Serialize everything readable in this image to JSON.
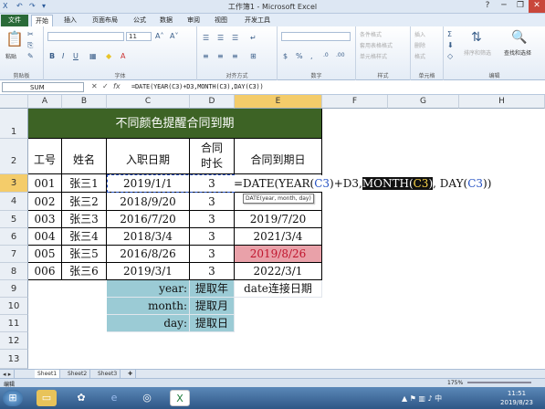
{
  "window": {
    "title": "工作簿1 - Microsoft Excel",
    "quick_access": [
      "X",
      "↶",
      "↷",
      "▾"
    ],
    "controls": [
      "?",
      "─",
      "❐",
      "✕"
    ]
  },
  "ribbon": {
    "tabs": [
      "文件",
      "开始",
      "插入",
      "页面布局",
      "公式",
      "数据",
      "审阅",
      "视图",
      "开发工具"
    ],
    "active_tab": "开始",
    "groups": [
      "剪贴板",
      "字体",
      "对齐方式",
      "数字",
      "样式",
      "单元格",
      "编辑"
    ],
    "paste_label": "粘贴",
    "font_size": "11",
    "style_items": [
      "条件格式",
      "套用表格格式",
      "单元格样式"
    ],
    "cell_items": [
      "插入",
      "删除",
      "格式"
    ],
    "edit_items": [
      "排序和筛选",
      "查找和选择"
    ]
  },
  "formula_bar": {
    "name_box": "SUM",
    "formula": "=DATE(YEAR(C3)+D3,MONTH(C3),DAY(C3))"
  },
  "sheet": {
    "columns": [
      "A",
      "B",
      "C",
      "D",
      "E",
      "F",
      "G",
      "H"
    ],
    "rows": [
      "1",
      "2",
      "3",
      "4",
      "5",
      "6",
      "7",
      "8",
      "9",
      "10",
      "11",
      "12",
      "13"
    ],
    "title": "不同颜色提醒合同到期",
    "headers": [
      "工号",
      "姓名",
      "入职日期",
      "合同时长",
      "合同到期日"
    ],
    "data": [
      [
        "001",
        "张三1",
        "2019/1/1",
        "3",
        ""
      ],
      [
        "002",
        "张三2",
        "2018/9/20",
        "3",
        ""
      ],
      [
        "003",
        "张三3",
        "2016/7/20",
        "3",
        "2019/7/20"
      ],
      [
        "004",
        "张三4",
        "2018/3/4",
        "3",
        "2021/3/4"
      ],
      [
        "005",
        "张三5",
        "2016/8/26",
        "3",
        "2019/8/26"
      ],
      [
        "006",
        "张三6",
        "2019/3/1",
        "3",
        "2022/3/1"
      ]
    ],
    "notes": [
      {
        "label": "year:",
        "value": "提取年",
        "extra": "date连接日期"
      },
      {
        "label": "month:",
        "value": "提取月",
        "extra": ""
      },
      {
        "label": "day:",
        "value": "提取日",
        "extra": ""
      }
    ],
    "editor": {
      "p1": "=DATE(YEAR(",
      "r1": "C3",
      "p2": ")+D3,",
      "month": "MONTH(",
      "r2": "C3",
      "p3": ")",
      "p4": ", DAY(",
      "r3": "C3",
      "p5": "))"
    },
    "tooltip": "DATE(year, month, day)"
  },
  "sheet_tabs": [
    "Sheet1",
    "Sheet2",
    "Sheet3"
  ],
  "status": {
    "mode": "编辑",
    "zoom": "175%"
  },
  "taskbar": {
    "time": "11:51",
    "date": "2019/8/23"
  },
  "colors": {
    "title_bg": "#3d6325",
    "note_bg": "#9bcbd5",
    "alert_bg": "#e9a1a9",
    "selection": "#f4cc6a"
  }
}
